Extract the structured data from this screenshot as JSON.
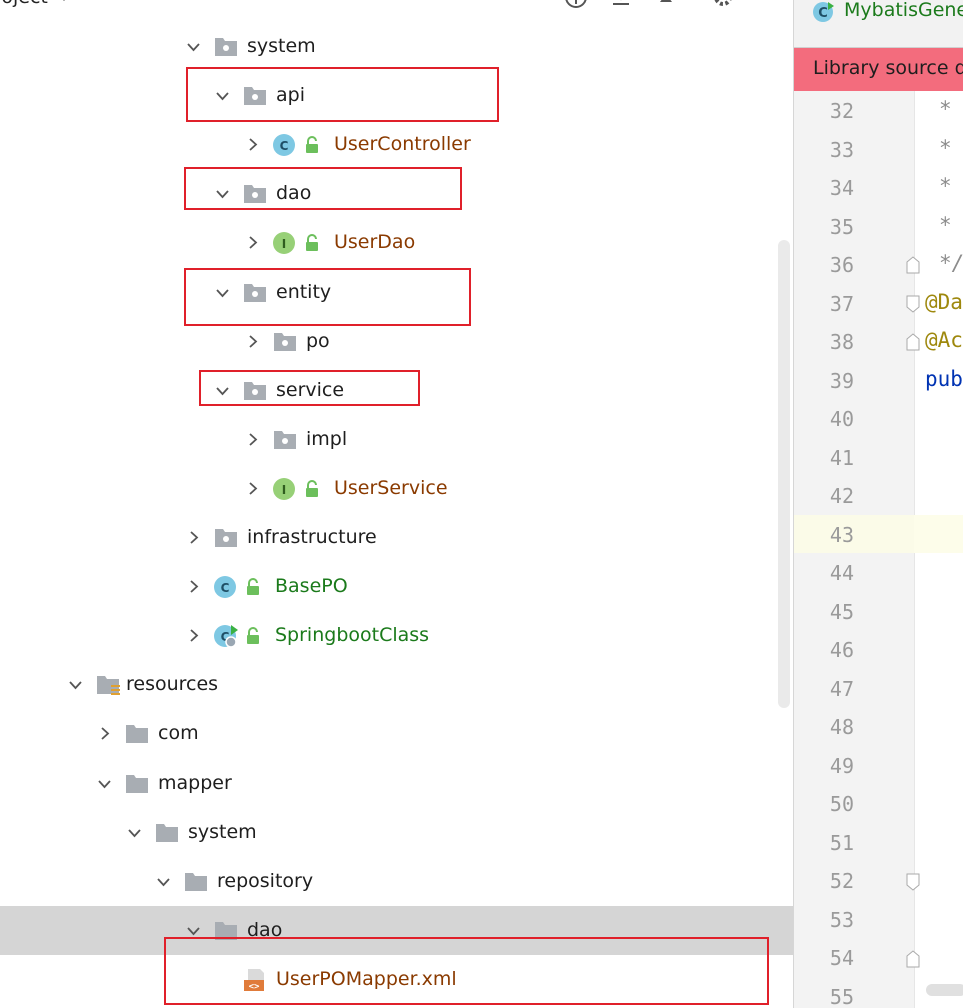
{
  "project_panel": {
    "title": "roject",
    "header_icons": [
      "locate-icon",
      "collapse-all-icon",
      "scroll-up-icon",
      "settings-icon"
    ],
    "tree": [
      {
        "label": "system",
        "kind": "package",
        "expanded": true,
        "color": "default"
      },
      {
        "label": "api",
        "kind": "package",
        "expanded": true,
        "color": "default",
        "highlighted": true
      },
      {
        "label": "UserController",
        "kind": "class",
        "expanded": false,
        "color": "brown",
        "badge": "C"
      },
      {
        "label": "dao",
        "kind": "package",
        "expanded": true,
        "color": "default",
        "highlighted": true
      },
      {
        "label": "UserDao",
        "kind": "interface",
        "expanded": false,
        "color": "brown",
        "badge": "I"
      },
      {
        "label": "entity",
        "kind": "package",
        "expanded": true,
        "color": "default",
        "highlighted": true
      },
      {
        "label": "po",
        "kind": "package",
        "expanded": false,
        "color": "default"
      },
      {
        "label": "service",
        "kind": "package",
        "expanded": true,
        "color": "default",
        "highlighted": true
      },
      {
        "label": "impl",
        "kind": "package",
        "expanded": false,
        "color": "default"
      },
      {
        "label": "UserService",
        "kind": "interface",
        "expanded": false,
        "color": "brown",
        "badge": "I"
      },
      {
        "label": "infrastructure",
        "kind": "package",
        "expanded": false,
        "color": "default"
      },
      {
        "label": "BasePO",
        "kind": "class",
        "expanded": false,
        "color": "green",
        "badge": "C"
      },
      {
        "label": "SpringbootClass",
        "kind": "runnable-class",
        "expanded": false,
        "color": "green",
        "badge": "C"
      },
      {
        "label": "resources",
        "kind": "resources-folder",
        "expanded": true,
        "color": "default"
      },
      {
        "label": "com",
        "kind": "folder",
        "expanded": false,
        "color": "default"
      },
      {
        "label": "mapper",
        "kind": "folder",
        "expanded": true,
        "color": "default"
      },
      {
        "label": "system",
        "kind": "folder",
        "expanded": true,
        "color": "default"
      },
      {
        "label": "repository",
        "kind": "folder",
        "expanded": true,
        "color": "default"
      },
      {
        "label": "dao",
        "kind": "folder",
        "expanded": true,
        "color": "default",
        "selected": true
      },
      {
        "label": "UserPOMapper.xml",
        "kind": "xml-file",
        "expanded": null,
        "color": "brown",
        "highlighted": true
      }
    ]
  },
  "editor": {
    "tab_label": "MybatisGene",
    "banner_text": "Library source do",
    "current_line": "43",
    "line_numbers": [
      "32",
      "33",
      "34",
      "35",
      "36",
      "37",
      "38",
      "39",
      "40",
      "41",
      "42",
      "43",
      "44",
      "45",
      "46",
      "47",
      "48",
      "49",
      "50",
      "51",
      "52",
      "53",
      "54",
      "55"
    ],
    "code_lines": [
      {
        "text": "*",
        "style": "comment"
      },
      {
        "text": "*",
        "style": "comment"
      },
      {
        "text": "*",
        "style": "comment"
      },
      {
        "text": "*",
        "style": "comment"
      },
      {
        "text": "*/",
        "style": "comment"
      },
      {
        "text": "@Da",
        "style": "annot"
      },
      {
        "text": "@Ac",
        "style": "annot"
      },
      {
        "text": "pub",
        "style": "keyword"
      }
    ]
  },
  "colors": {
    "highlight_box": "#e0202a",
    "banner": "#f36c7d",
    "selected_row": "#d5d5d5",
    "class_badge": "#7ec8e3",
    "interface_badge": "#97d077",
    "folder": "#a8adb3",
    "brown_text": "#8a3a00",
    "green_text": "#1b7a1b"
  }
}
